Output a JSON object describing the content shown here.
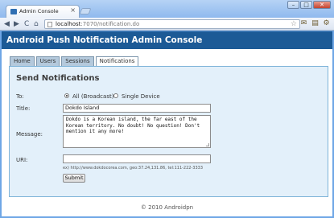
{
  "browser": {
    "tab_title": "Admin Console",
    "tab_close": "×",
    "window_buttons": [
      "–",
      "□",
      "✕"
    ],
    "nav": {
      "back": "◀",
      "forward": "▶",
      "reload": "C",
      "home": "⌂"
    },
    "url_host": "localhost",
    "url_rest": ":7070/notification.do",
    "star": "☆"
  },
  "app": {
    "title": "Android Push Notification Admin Console",
    "tabs": [
      "Home",
      "Users",
      "Sessions",
      "Notifications"
    ],
    "active_tab": "Notifications"
  },
  "form": {
    "heading": "Send Notifications",
    "to_label": "To:",
    "to_options": [
      "All (Broadcast)",
      "Single Device"
    ],
    "to_selected": "All (Broadcast)",
    "title_label": "Title:",
    "title_value": "Dokdo Island",
    "message_label": "Message:",
    "message_value": "Dokdo is a Korean island, the far east of the Korean territory. No doubt! No question! Don't mention it any more!",
    "uri_label": "URI:",
    "uri_value": "",
    "uri_hint": "ex) http://www.dokdocorea.com, geo:37.24,131.86, tel:111-222-3333",
    "submit_label": "Submit"
  },
  "footer": "© 2010 Androidpn"
}
